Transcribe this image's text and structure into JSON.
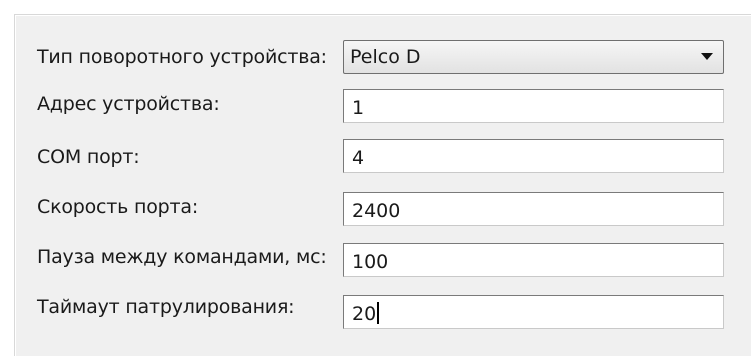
{
  "form": {
    "device_type": {
      "label": "Тип поворотного устройства:",
      "value": "Pelco D"
    },
    "device_address": {
      "label": "Адрес устройства:",
      "value": "1"
    },
    "com_port": {
      "label": "COM порт:",
      "value": "4"
    },
    "port_speed": {
      "label": "Скорость порта:",
      "value": "2400"
    },
    "command_pause": {
      "label": "Пауза между командами, мс:",
      "value": "100"
    },
    "patrol_timeout": {
      "label": "Таймаут патрулирования:",
      "value": "20"
    }
  },
  "icons": {
    "dropdown": "chevron-down-icon"
  }
}
